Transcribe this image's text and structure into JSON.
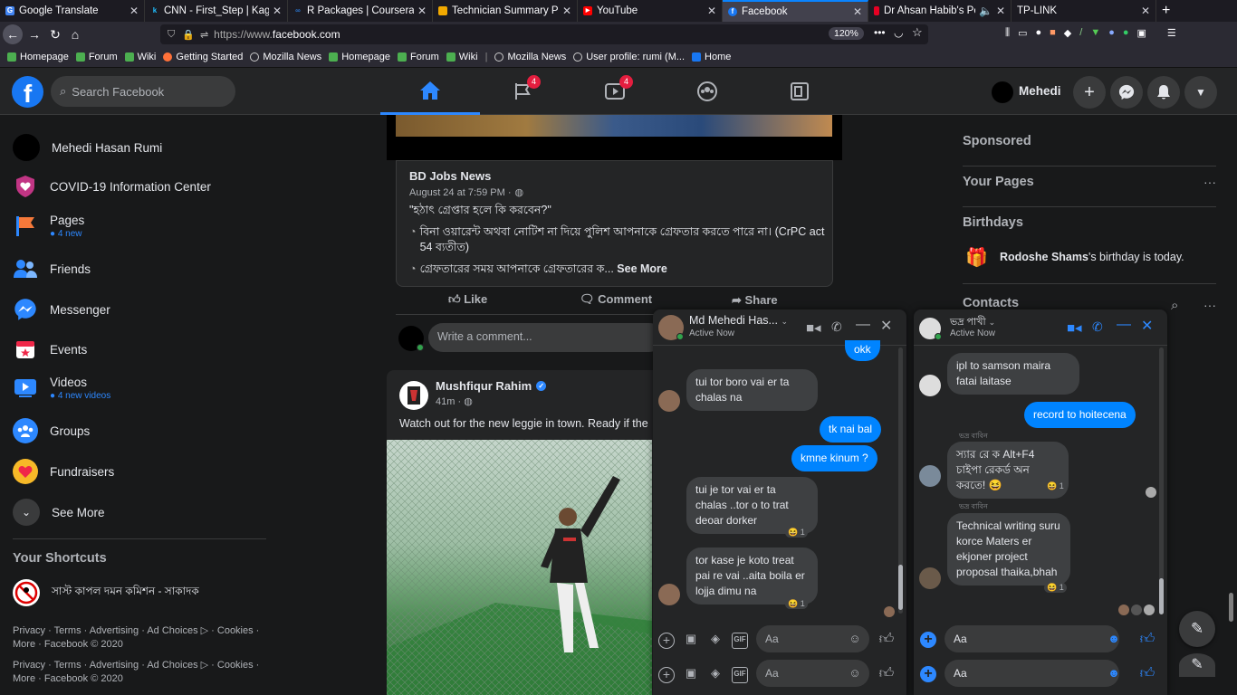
{
  "browser": {
    "tabs": [
      {
        "title": "Google Translate",
        "color": "#4285f4",
        "icon": "G"
      },
      {
        "title": "CNN - First_Step | Kaggle",
        "color": "#20beff",
        "icon": "k"
      },
      {
        "title": "R Packages | Coursera",
        "color": "#2a73cc",
        "icon": "∞"
      },
      {
        "title": "Technician Summary Print",
        "color": "#f2a900",
        "icon": "▪"
      },
      {
        "title": "YouTube",
        "color": "#ff0000",
        "icon": "▶"
      },
      {
        "title": "Facebook",
        "color": "#1877f2",
        "icon": "f"
      },
      {
        "title": "Dr Ahsan Habib's Personal",
        "color": "#e60023",
        "icon": "▮"
      },
      {
        "title": "TP-LINK",
        "color": "#2b2a33",
        "icon": ""
      }
    ],
    "url_prefix": "https://www.",
    "url_domain": "facebook.com",
    "zoom": "120%",
    "bookmarks": [
      "Homepage",
      "Forum",
      "Wiki",
      "Getting Started",
      "Mozilla News",
      "Homepage",
      "Forum",
      "Wiki",
      "Mozilla News",
      "User profile: rumi (M...",
      "Home"
    ]
  },
  "header": {
    "search_placeholder": "Search Facebook",
    "watch_badge": "4",
    "pages_badge": "4",
    "profile_name": "Mehedi"
  },
  "sidebar": {
    "items": [
      {
        "label": "Mehedi Hasan Rumi",
        "sub": ""
      },
      {
        "label": "COVID-19 Information Center",
        "sub": ""
      },
      {
        "label": "Pages",
        "sub": "4 new"
      },
      {
        "label": "Friends",
        "sub": ""
      },
      {
        "label": "Messenger",
        "sub": ""
      },
      {
        "label": "Events",
        "sub": ""
      },
      {
        "label": "Videos",
        "sub": "4 new videos"
      },
      {
        "label": "Groups",
        "sub": ""
      },
      {
        "label": "Fundraisers",
        "sub": ""
      },
      {
        "label": "See More",
        "sub": ""
      }
    ],
    "shortcuts_title": "Your Shortcuts",
    "shortcut_item": "সাস্ট কাপল দমন কমিশন - সাকাদক",
    "footer1": "Privacy · Terms · Advertising · Ad Choices ▷ · Cookies · More · Facebook © 2020",
    "footer2": "Privacy · Terms · Advertising · Ad Choices ▷ · Cookies · More · Facebook © 2020"
  },
  "post1": {
    "author": "BD Jobs News",
    "date": "August 24 at 7:59 PM ·",
    "line1": "\"হঠাৎ গ্রেপ্তার হলে কি করবেন?\"",
    "line2": "বিনা ওয়ারেন্ট অথবা নোটিশ না দিয়ে পুলিশ আপনাকে গ্রেফতার করতে পারে না। (CrPC act 54 ব্যতীত)",
    "line3": "গ্রেফতারের সময় আপনাকে গ্রেফতারের ক...",
    "see_more": "See More",
    "like": "Like",
    "comment": "Comment",
    "share": "Share",
    "comment_placeholder": "Write a comment..."
  },
  "post2": {
    "author": "Mushfiqur Rahim",
    "time": "41m ·",
    "text": "Watch out for the new leggie in town. Ready if the"
  },
  "right": {
    "sponsored": "Sponsored",
    "your_pages": "Your Pages",
    "birthdays": "Birthdays",
    "birthday_name": "Rodoshe Shams",
    "birthday_rest": "'s birthday is today.",
    "contacts": "Contacts"
  },
  "chat1": {
    "name": "Md Mehedi Has...",
    "status": "Active Now",
    "messages": [
      {
        "text": "okk"
      },
      {
        "text": "tui tor boro vai er ta chalas na"
      },
      {
        "text": "tk nai bal"
      },
      {
        "text": "kmne kinum ?"
      },
      {
        "text": "tui je tor vai er ta chalas ..tor o to trat deoar dorker"
      },
      {
        "text": "tor kase je koto treat pai re vai ..aita boila er lojja dimu na"
      }
    ],
    "reaction": "😆 1",
    "input1": "Aa",
    "input2": "Aa"
  },
  "chat2": {
    "name": "ভদ্র পাখী",
    "status": "Active Now",
    "messages": [
      {
        "text": "ipl to samson maira fatai laitase"
      },
      {
        "text": "record to hoitecena"
      },
      {
        "text": "স্যার রে ক Alt+F4 চাইপা রেকর্ড অন করতে! 😆"
      },
      {
        "text": "Technical writing suru korce Maters er ekjoner  project proposal thaika,bhah"
      }
    ],
    "sender": "ভদ্র বাবিন",
    "reaction": "😆 1",
    "input1": "Aa",
    "input2": "Aa"
  }
}
